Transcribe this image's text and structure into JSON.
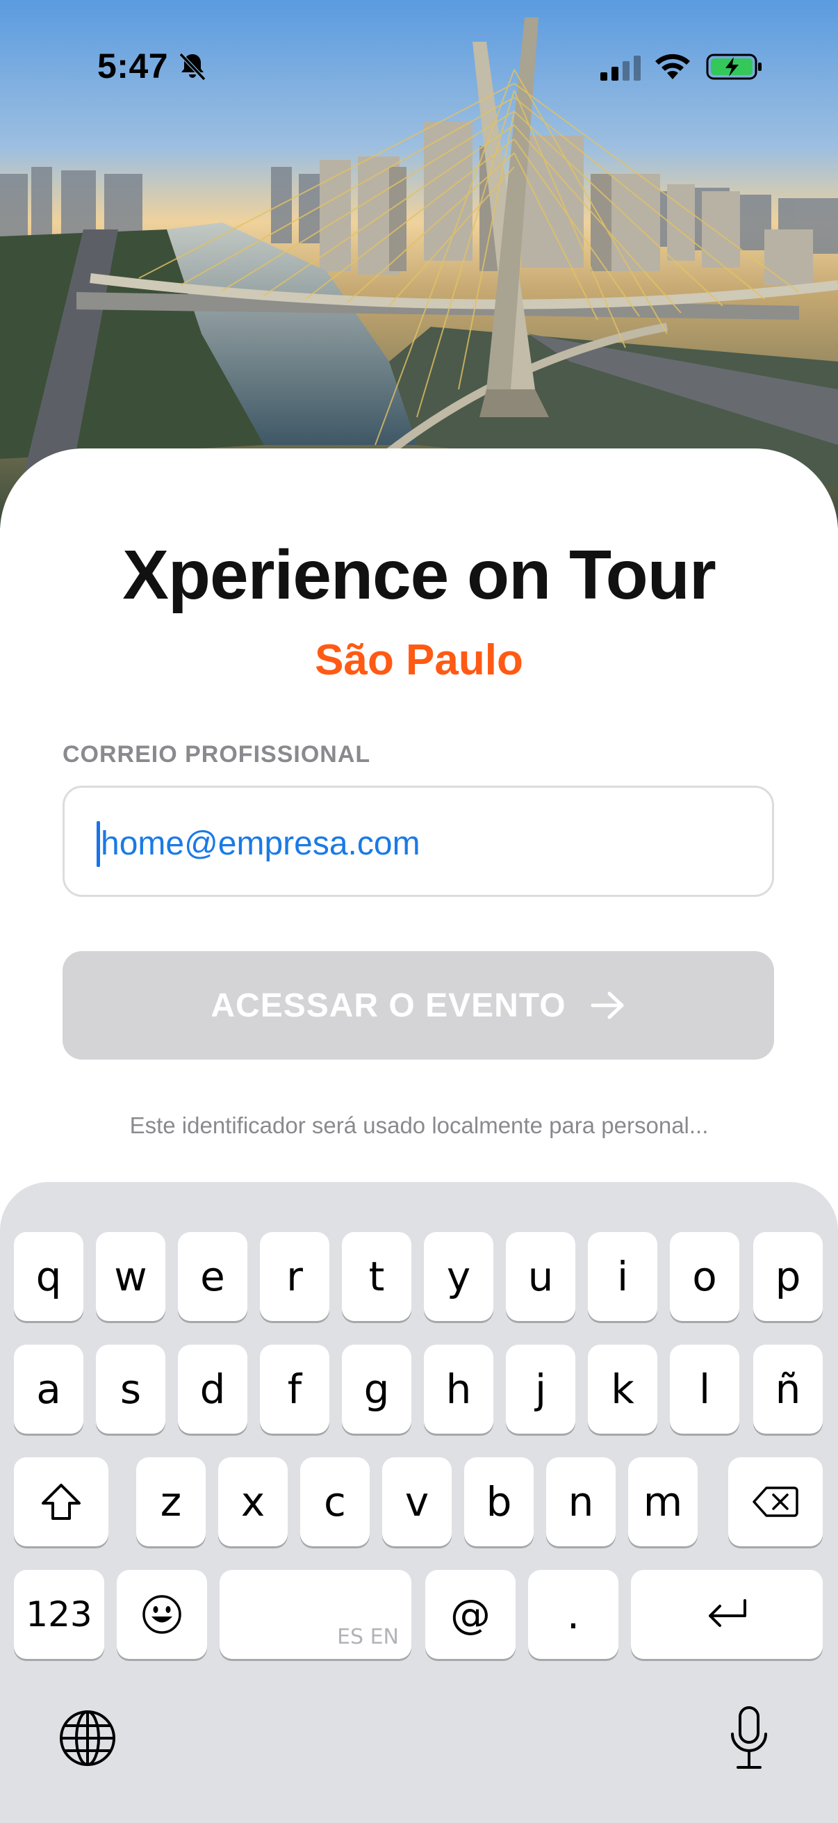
{
  "status_bar": {
    "time": "5:47",
    "icons": [
      "bell-slash-icon",
      "cellular-signal-icon",
      "wifi-icon",
      "battery-charging-icon"
    ]
  },
  "hero": {
    "image": "são-paulo-bridge-photo"
  },
  "header": {
    "title": "Xperience on Tour",
    "subtitle": "São Paulo"
  },
  "form": {
    "email_label": "CORREIO PROFISSIONAL",
    "email_placeholder": "home@empresa.com",
    "email_value": "",
    "submit_label": "ACESSAR O EVENTO",
    "submit_icon": "arrow-right-icon",
    "hint": "Este identificador será usado localmente para personal..."
  },
  "keyboard": {
    "row1": [
      "q",
      "w",
      "e",
      "r",
      "t",
      "y",
      "u",
      "i",
      "o",
      "p"
    ],
    "row2": [
      "a",
      "s",
      "d",
      "f",
      "g",
      "h",
      "j",
      "k",
      "l",
      "ñ"
    ],
    "row3": [
      "z",
      "x",
      "c",
      "v",
      "b",
      "n",
      "m"
    ],
    "numbers_key": "123",
    "at_key": "@",
    "dot_key": ".",
    "space_languages": "ES EN",
    "icons": [
      "shift-icon",
      "backspace-icon",
      "emoji-icon",
      "return-icon",
      "globe-icon",
      "microphone-icon"
    ]
  },
  "colors": {
    "accent": "#ff5a14",
    "link_blue": "#1a7ae6",
    "button_disabled": "#d4d4d6",
    "keyboard_bg": "#dfe0e4"
  }
}
